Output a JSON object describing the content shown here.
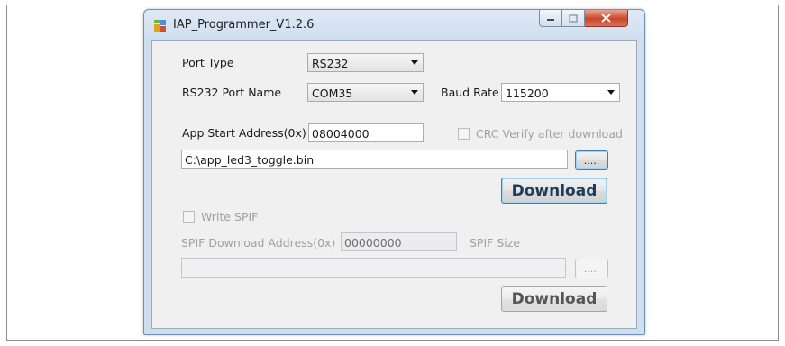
{
  "window": {
    "title": "IAP_Programmer_V1.2.6"
  },
  "caption": {
    "minimize": "–",
    "maximize": "□",
    "close": "✕"
  },
  "form": {
    "port_type_label": "Port Type",
    "port_type_value": "RS232",
    "port_name_label": "RS232 Port Name",
    "port_name_value": "COM35",
    "baud_label": "Baud Rate",
    "baud_value": "115200",
    "app_addr_label": "App Start Address(0x)",
    "app_addr_value": "08004000",
    "crc_label": "CRC Verify after download",
    "file_path": "C:\\app_led3_toggle.bin",
    "browse_label": ".....",
    "download_label": "Download",
    "write_spif_label": "Write SPIF",
    "spif_addr_label": "SPIF Download Address(0x)",
    "spif_addr_value": "00000000",
    "spif_size_label": "SPIF Size",
    "spif_file_path": "",
    "spif_browse_label": ".....",
    "spif_download_label": "Download"
  },
  "colors": {
    "title_bar": "#cfdeef",
    "client_bg": "#f0f0f0",
    "close_button": "#c9462c",
    "primary_border": "#3c7fb1"
  }
}
